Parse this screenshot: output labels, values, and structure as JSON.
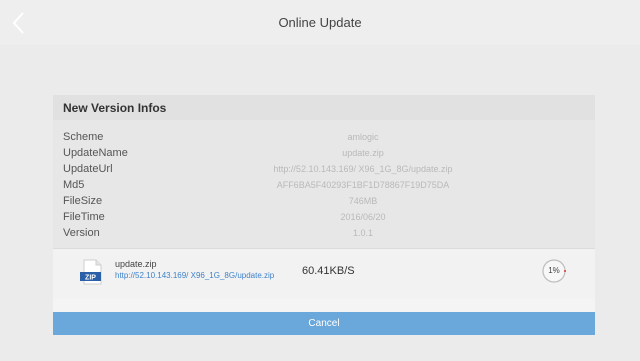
{
  "header": {
    "title": "Online Update",
    "back_icon": "chevron-left-icon"
  },
  "card": {
    "title": "New Version Infos",
    "rows": [
      {
        "key": "Scheme",
        "value": "amlogic"
      },
      {
        "key": "UpdateName",
        "value": "update.zip"
      },
      {
        "key": "UpdateUrl",
        "value": "http://52.10.143.169/ X96_1G_8G/update.zip"
      },
      {
        "key": "Md5",
        "value": "AFF6BA5F40293F1BF1D78867F19D75DA"
      },
      {
        "key": "FileSize",
        "value": "746MB"
      },
      {
        "key": "FileTime",
        "value": "2016/06/20"
      },
      {
        "key": "Version",
        "value": "1.0.1"
      }
    ]
  },
  "download": {
    "icon": "zip-file-icon",
    "icon_label": "ZIP",
    "file_name": "update.zip",
    "url": "http://52.10.143.169/ X96_1G_8G/update.zip",
    "speed": "60.41KB/S",
    "progress_label": "1%",
    "progress_fraction": 0.01
  },
  "actions": {
    "cancel_label": "Cancel"
  },
  "colors": {
    "accent": "#6aa7db",
    "link": "#3f82c9",
    "progress": "#e04a4a"
  }
}
